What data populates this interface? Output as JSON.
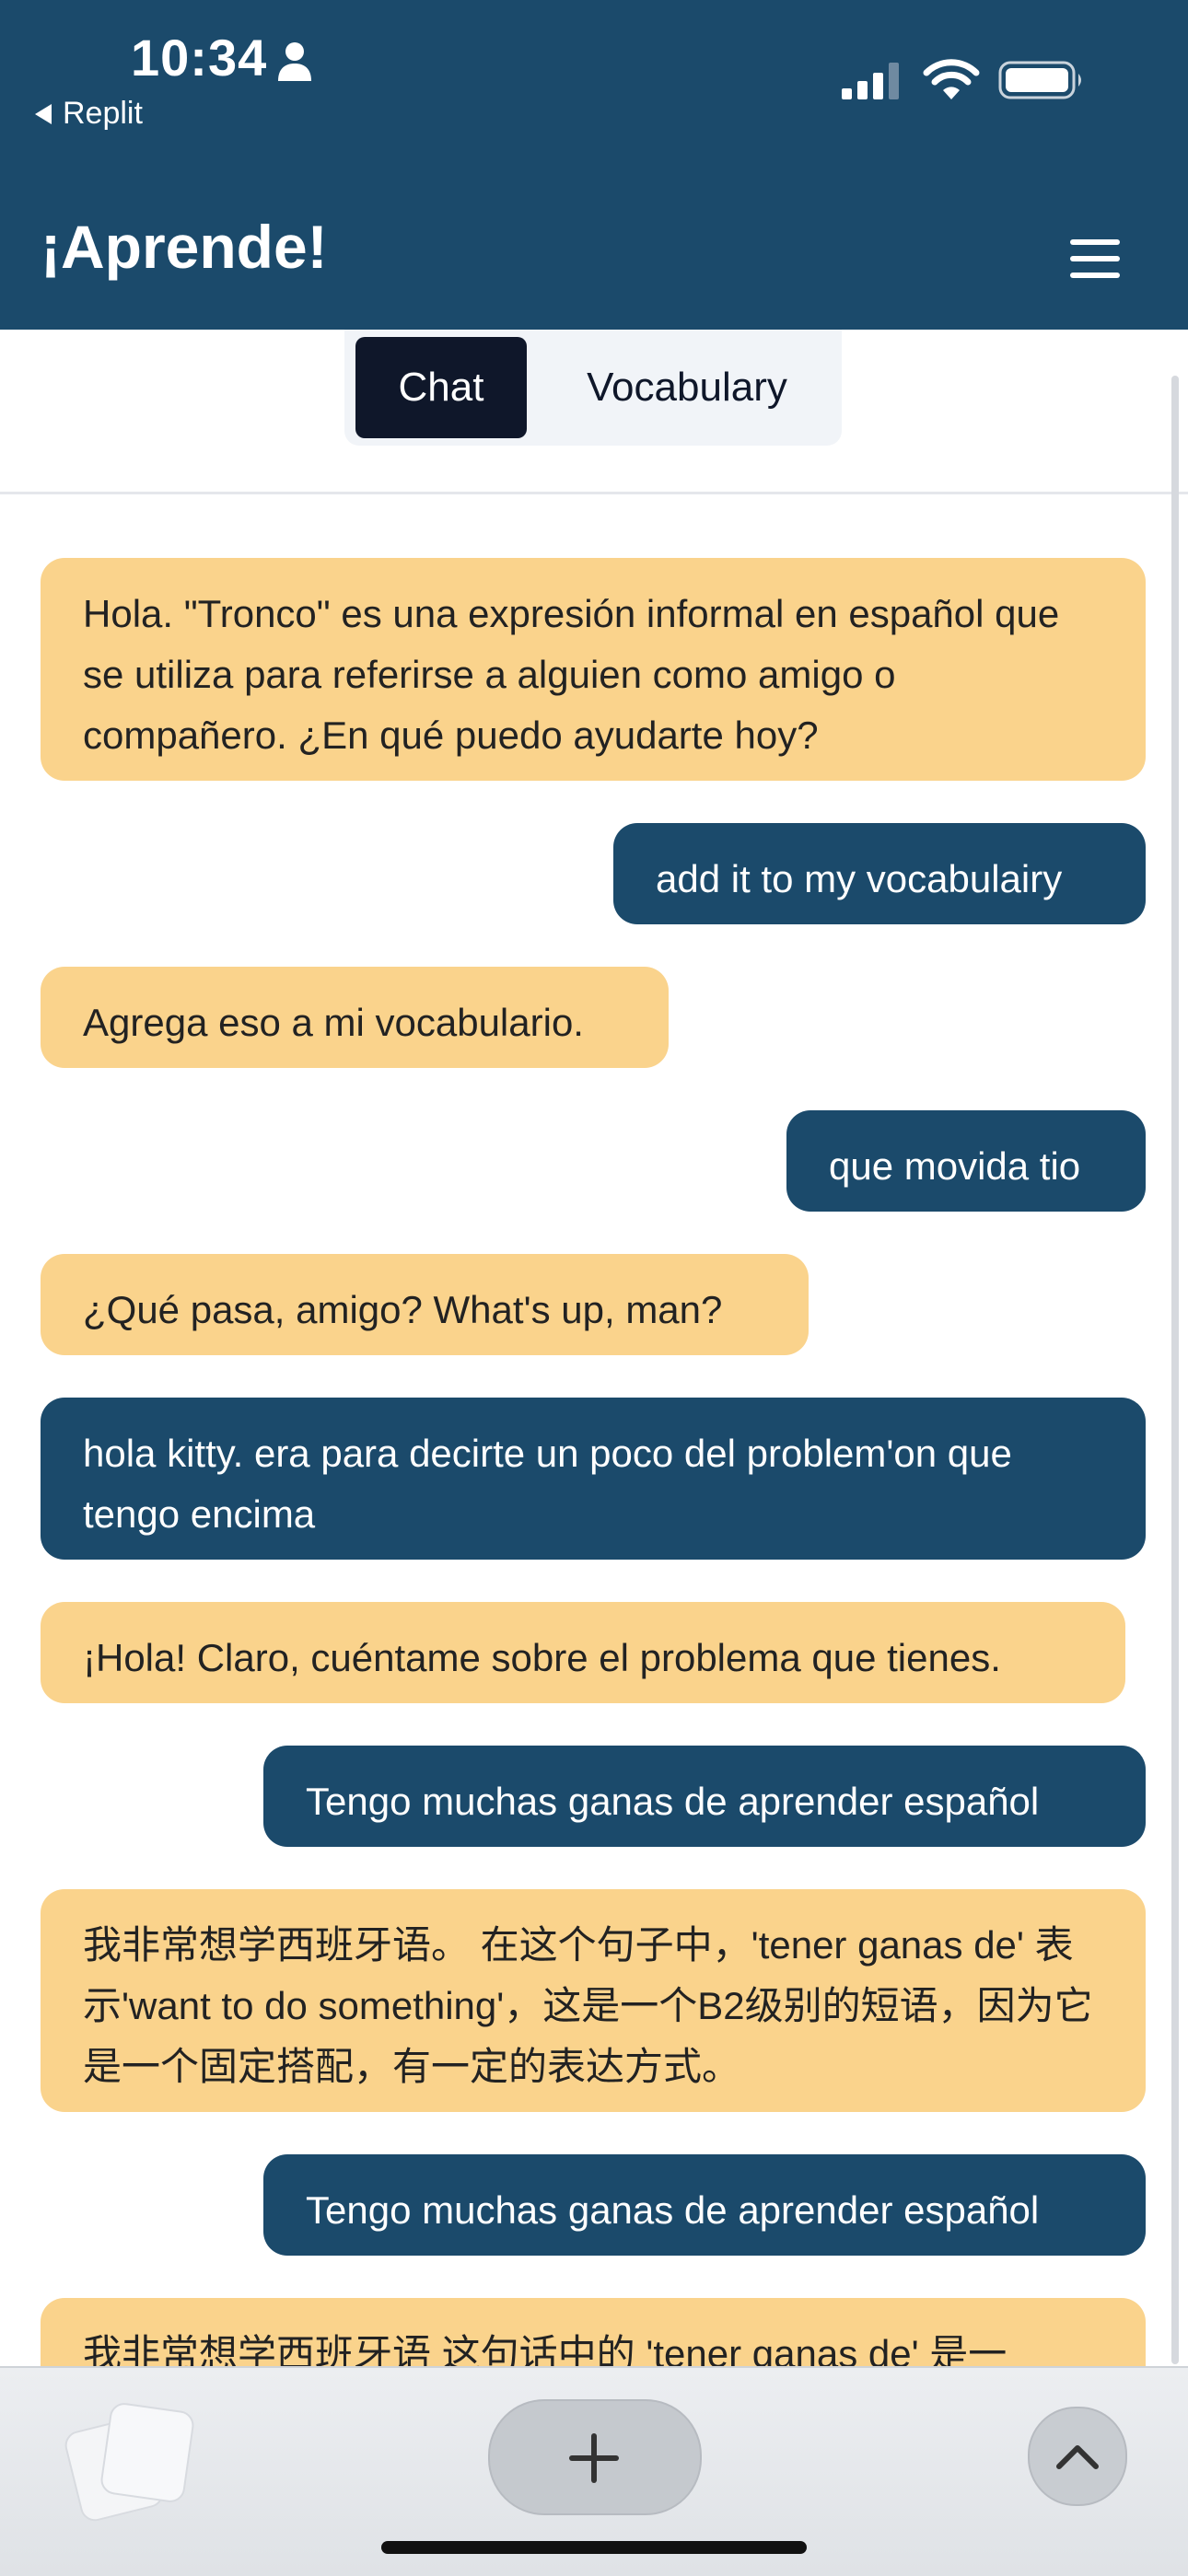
{
  "status_bar": {
    "time": "10:34",
    "back_label": "Replit"
  },
  "header": {
    "title": "¡Aprende!"
  },
  "tabs": [
    {
      "label": "Chat",
      "active": true
    },
    {
      "label": "Vocabulary",
      "active": false
    }
  ],
  "messages": [
    {
      "role": "bot",
      "text": "Hola. \"Tronco\" es una expresión informal en español que se utiliza para referirse a alguien como amigo o compañero. ¿En qué puedo ayudarte hoy?"
    },
    {
      "role": "user",
      "text": "add it to my vocabulairy"
    },
    {
      "role": "bot",
      "text": "Agrega eso a mi vocabulario."
    },
    {
      "role": "user",
      "text": "que movida tio"
    },
    {
      "role": "bot",
      "text": "¿Qué pasa, amigo? What's up, man?"
    },
    {
      "role": "user",
      "text": "hola kitty. era para decirte un poco del problem'on que tengo encima"
    },
    {
      "role": "bot",
      "text": "¡Hola! Claro, cuéntame sobre el problema que tienes."
    },
    {
      "role": "user",
      "text": "Tengo muchas ganas de aprender español"
    },
    {
      "role": "bot",
      "text": "我非常想学西班牙语。 在这个句子中，'tener ganas de' 表示'want to do something'，这是一个B2级别的短语，因为它是一个固定搭配，有一定的表达方式。"
    },
    {
      "role": "user",
      "text": "Tengo muchas ganas de aprender español"
    },
    {
      "role": "bot",
      "text": "我非常想学西班牙语 这句话中的 'tener ganas de' 是一"
    }
  ],
  "colors": {
    "header_bg": "#1b4a6b",
    "bot_bubble": "#fad38c",
    "user_bubble": "#1b4a6b",
    "active_tab": "#0f172a"
  }
}
